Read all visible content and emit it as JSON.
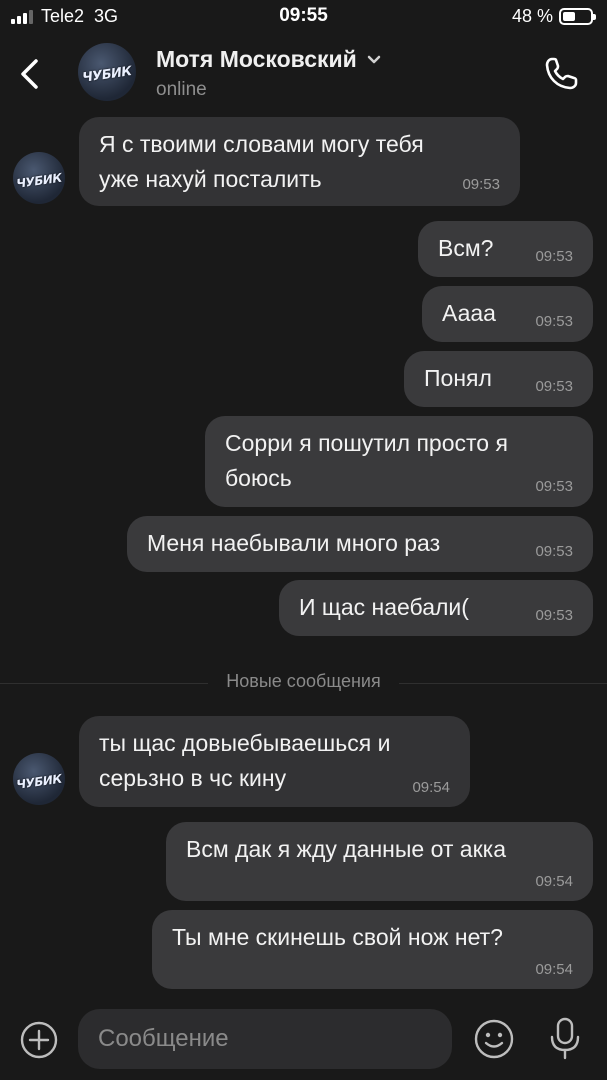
{
  "status_bar": {
    "carrier": "Tele2",
    "network": "3G",
    "time": "09:55",
    "battery_text": "48 %",
    "battery_level": 0.48
  },
  "header": {
    "contact_name": "Мотя Московский",
    "status": "online",
    "avatar_text": "ЧУБИК"
  },
  "messages": [
    {
      "direction": "in",
      "text_lines": [
        "Я с твоими словами могу тебя",
        "уже нахуй посталить"
      ],
      "time": "09:53"
    },
    {
      "direction": "out",
      "text_lines": [
        "Всм?"
      ],
      "time": "09:53"
    },
    {
      "direction": "out",
      "text_lines": [
        "Аааа"
      ],
      "time": "09:53"
    },
    {
      "direction": "out",
      "text_lines": [
        "Понял"
      ],
      "time": "09:53"
    },
    {
      "direction": "out",
      "text_lines": [
        "Сорри я пошутил просто я",
        "боюсь"
      ],
      "time": "09:53"
    },
    {
      "direction": "out",
      "text_lines": [
        "Меня наебывали много раз"
      ],
      "time": "09:53"
    },
    {
      "direction": "out",
      "text_lines": [
        "И щас наебали("
      ],
      "time": "09:53"
    },
    {
      "direction": "in",
      "text_lines": [
        "ты щас довыебываешься и",
        "серьзно в чс кину"
      ],
      "time": "09:54"
    },
    {
      "direction": "out",
      "text_lines": [
        "Всм дак я жду данные от акка"
      ],
      "time": "09:54"
    },
    {
      "direction": "out",
      "text_lines": [
        "Ты мне скинешь свой нож нет?"
      ],
      "time": "09:54"
    }
  ],
  "new_messages_label": "Новые сообщения",
  "composer": {
    "placeholder": "Сообщение"
  },
  "colors": {
    "background": "#191919",
    "bubble": "#333335",
    "time_text": "#9b9b9b"
  },
  "icons": [
    "back-arrow-icon",
    "chevron-down-icon",
    "phone-icon",
    "plus-circle-icon",
    "emoji-icon",
    "microphone-icon"
  ]
}
